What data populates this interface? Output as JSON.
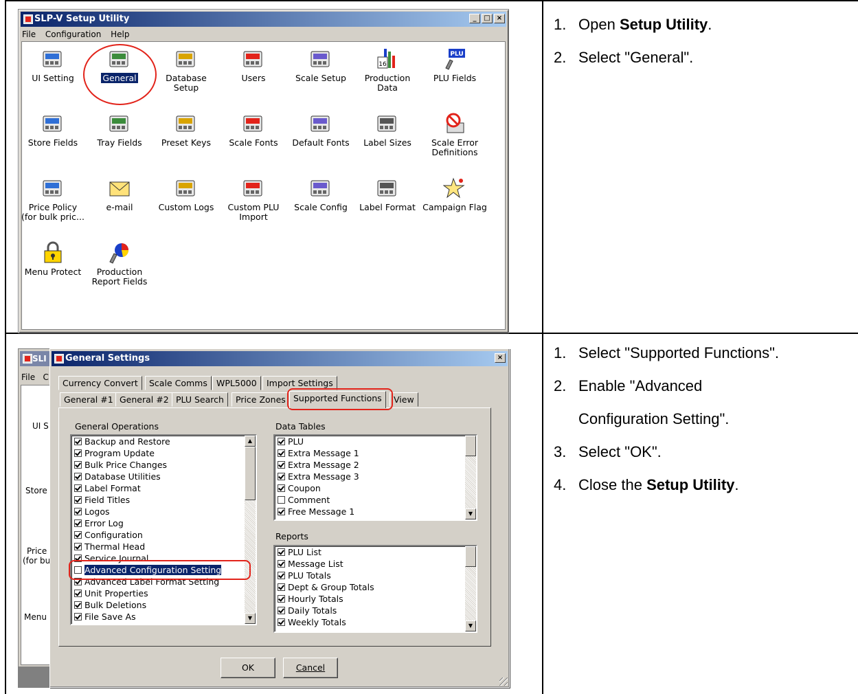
{
  "setup_window": {
    "title": "SLP-V Setup Utility",
    "menu": [
      "File",
      "Configuration",
      "Help"
    ],
    "icons": [
      {
        "label": "UI Setting",
        "icon": "ui-setting-icon"
      },
      {
        "label": "General",
        "icon": "general-icon",
        "selected": true
      },
      {
        "label": "Database Setup",
        "icon": "database-icon"
      },
      {
        "label": "Users",
        "icon": "users-icon"
      },
      {
        "label": "Scale Setup",
        "icon": "scale-setup-icon"
      },
      {
        "label": "Production Data",
        "icon": "production-data-icon"
      },
      {
        "label": "PLU Fields",
        "icon": "plu-fields-icon"
      },
      {
        "label": "Store Fields",
        "icon": "store-fields-icon"
      },
      {
        "label": "Tray Fields",
        "icon": "tray-fields-icon"
      },
      {
        "label": "Preset Keys",
        "icon": "preset-keys-icon"
      },
      {
        "label": "Scale Fonts",
        "icon": "scale-fonts-icon"
      },
      {
        "label": "Default Fonts",
        "icon": "default-fonts-icon"
      },
      {
        "label": "Label Sizes",
        "icon": "label-sizes-icon"
      },
      {
        "label": "Scale Error Definitions",
        "icon": "scale-error-icon"
      },
      {
        "label": "Price Policy (for bulk pric...",
        "icon": "price-policy-icon"
      },
      {
        "label": "e-mail",
        "icon": "email-icon"
      },
      {
        "label": "Custom Logs",
        "icon": "custom-logs-icon"
      },
      {
        "label": "Custom PLU Import",
        "icon": "custom-plu-import-icon"
      },
      {
        "label": "Scale Config",
        "icon": "scale-config-icon"
      },
      {
        "label": "Label Format",
        "icon": "label-format-icon"
      },
      {
        "label": "Campaign Flag",
        "icon": "campaign-flag-icon"
      },
      {
        "label": "Menu Protect",
        "icon": "menu-protect-icon"
      },
      {
        "label": "Production Report Fields",
        "icon": "production-report-icon"
      }
    ],
    "icon_glyphs": {
      "plu": "PLU",
      "sixteen": "16"
    }
  },
  "instructions_1": {
    "step1_num": "1.",
    "step1_pre": "Open ",
    "step1_bold": "Setup Utility",
    "step1_post": ".",
    "step2_num": "2.",
    "step2_text": "Select \"General\"."
  },
  "general_dialog": {
    "title": "General Settings",
    "behind_title": "SLI",
    "behind_menu": [
      "File",
      "C"
    ],
    "behind_labels": [
      "UI S",
      "Store",
      "Price",
      "(for bu",
      "Menu"
    ],
    "tabs_row1": [
      "Currency Convert",
      "Scale Comms",
      "WPL5000",
      "Import Settings"
    ],
    "tabs_row2": [
      "General #1",
      "General #2",
      "PLU Search",
      "Price Zones",
      "Supported Functions",
      "View"
    ],
    "active_tab": "Supported Functions",
    "general_operations_label": "General Operations",
    "general_operations": [
      {
        "label": "Backup and Restore",
        "checked": true
      },
      {
        "label": "Program Update",
        "checked": true
      },
      {
        "label": "Bulk Price Changes",
        "checked": true
      },
      {
        "label": "Database Utilities",
        "checked": true
      },
      {
        "label": "Label Format",
        "checked": true
      },
      {
        "label": "Field Titles",
        "checked": true
      },
      {
        "label": "Logos",
        "checked": true
      },
      {
        "label": "Error Log",
        "checked": true
      },
      {
        "label": "Configuration",
        "checked": true
      },
      {
        "label": "Thermal Head",
        "checked": true
      },
      {
        "label": "Service Journal",
        "checked": true
      },
      {
        "label": "Advanced Configuration Setting",
        "checked": false,
        "highlighted": true
      },
      {
        "label": "Advanced Label Format Setting",
        "checked": true
      },
      {
        "label": "Unit Properties",
        "checked": true
      },
      {
        "label": "Bulk Deletions",
        "checked": true
      },
      {
        "label": "File Save As",
        "checked": true
      }
    ],
    "data_tables_label": "Data Tables",
    "data_tables": [
      {
        "label": "PLU",
        "checked": true
      },
      {
        "label": "Extra Message 1",
        "checked": true
      },
      {
        "label": "Extra Message 2",
        "checked": true
      },
      {
        "label": "Extra Message 3",
        "checked": true
      },
      {
        "label": "Coupon",
        "checked": true
      },
      {
        "label": "Comment",
        "checked": false
      },
      {
        "label": "Free Message 1",
        "checked": true
      }
    ],
    "reports_label": "Reports",
    "reports": [
      {
        "label": "PLU List",
        "checked": true
      },
      {
        "label": "Message List",
        "checked": true
      },
      {
        "label": "PLU Totals",
        "checked": true
      },
      {
        "label": "Dept & Group Totals",
        "checked": true
      },
      {
        "label": "Hourly Totals",
        "checked": true
      },
      {
        "label": "Daily Totals",
        "checked": true
      },
      {
        "label": "Weekly Totals",
        "checked": true
      }
    ],
    "ok_label": "OK",
    "cancel_label": "Cancel",
    "close_glyph": "×"
  },
  "instructions_2": {
    "step1_num": "1.",
    "step1_text": "Select \"Supported Functions\".",
    "step2_num": "2.",
    "step2_text_a": "Enable \"Advanced",
    "step2_text_b": "Configuration Setting\".",
    "step3_num": "3.",
    "step3_text": "Select \"OK\".",
    "step4_num": "4.",
    "step4_pre": "Close the ",
    "step4_bold": "Setup Utility",
    "step4_post": "."
  },
  "colors": {
    "annotation_red": "#e2231a",
    "title_blue": "#0a246a",
    "face": "#d4d0c8"
  }
}
